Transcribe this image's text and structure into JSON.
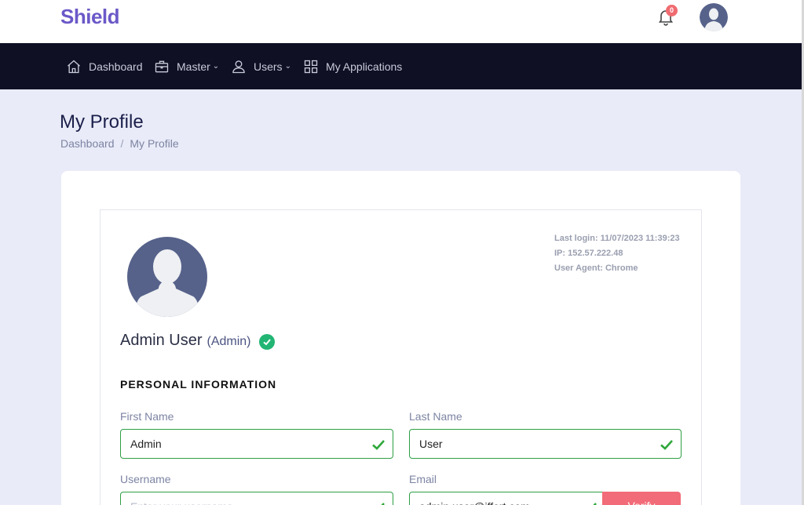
{
  "app": {
    "logo": "Shield"
  },
  "header": {
    "notifications_count": "0"
  },
  "nav": {
    "items": [
      {
        "label": "Dashboard",
        "icon": "home-icon"
      },
      {
        "label": "Master",
        "icon": "briefcase-icon",
        "has_dropdown": true
      },
      {
        "label": "Users",
        "icon": "user-icon",
        "has_dropdown": true
      },
      {
        "label": "My Applications",
        "icon": "grid-icon"
      }
    ]
  },
  "page": {
    "title": "My Profile",
    "breadcrumb": [
      "Dashboard",
      "My Profile"
    ]
  },
  "profile": {
    "last_login": "Last login: 11/07/2023 11:39:23",
    "ip": "IP: 152.57.222.48",
    "user_agent": "User Agent: Chrome",
    "name": "Admin User",
    "role": "(Admin)"
  },
  "form": {
    "section_title": "PERSONAL INFORMATION",
    "first_name": {
      "label": "First Name",
      "value": "Admin"
    },
    "last_name": {
      "label": "Last Name",
      "value": "User"
    },
    "username": {
      "label": "Username",
      "placeholder": "Enter your username"
    },
    "email": {
      "label": "Email",
      "value": "admin.user@iffort.com"
    },
    "verify_label": "Verify"
  },
  "colors": {
    "brand": "#6a59c8",
    "nav_bg": "#0f1024",
    "valid_border": "#2f9e44",
    "verify_button": "#f26b78",
    "verified_badge": "#22b573"
  }
}
